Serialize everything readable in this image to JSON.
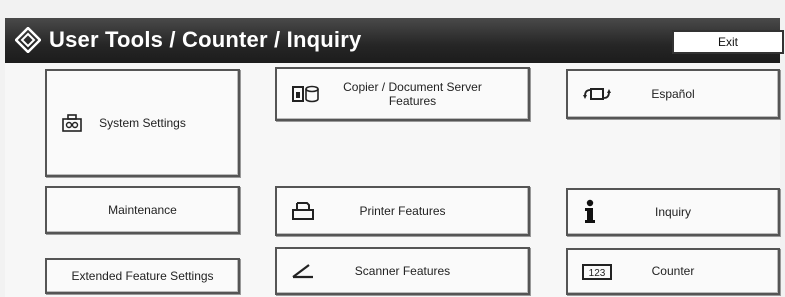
{
  "header": {
    "title": "User Tools / Counter / Inquiry",
    "exit_label": "Exit"
  },
  "buttons": {
    "system_settings": "System Settings",
    "copier_features": "Copier / Document Server Features",
    "language": "Español",
    "maintenance": "Maintenance",
    "printer_features": "Printer Features",
    "inquiry": "Inquiry",
    "extended_feature_settings": "Extended Feature Settings",
    "scanner_features": "Scanner Features",
    "counter": "Counter"
  },
  "icons": {
    "title": "user-tools-diamond-icon",
    "system_settings": "system-settings-icon",
    "copier": "copier-document-server-icon",
    "language": "language-switch-icon",
    "printer": "printer-icon",
    "inquiry": "info-icon",
    "scanner": "scanner-icon",
    "counter": "counter-123-icon",
    "counter_text": "123"
  },
  "colors": {
    "titlebar": "#262626",
    "title_text": "#ffffff",
    "button_border": "#555555",
    "background": "#f2f2f2"
  }
}
